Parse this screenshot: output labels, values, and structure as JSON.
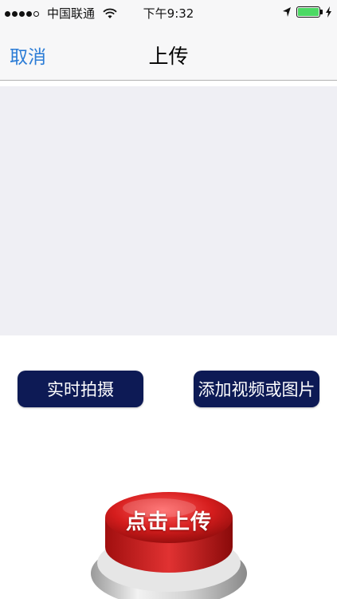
{
  "status_bar": {
    "carrier": "中国联通",
    "time": "下午9:32",
    "battery_color": "#4cd964",
    "signal_icon": "signal-dots-icon",
    "wifi_icon": "wifi-icon",
    "location_icon": "location-arrow-icon",
    "battery_icon": "battery-icon",
    "charging_icon": "charging-bolt-icon"
  },
  "nav": {
    "cancel_label": "取消",
    "title": "上传",
    "accent_color": "#2b7cd6"
  },
  "actions": {
    "capture_label": "实时拍摄",
    "add_media_label": "添加视频或图片",
    "button_color": "#0d1a55"
  },
  "upload": {
    "label": "点击上传",
    "button_color": "#d32020"
  }
}
